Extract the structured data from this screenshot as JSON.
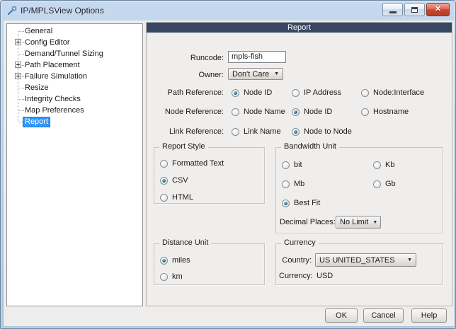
{
  "window": {
    "title": "IP/MPLSView Options"
  },
  "icons": {
    "app": "wrench-icon",
    "minimize": "minimize-icon",
    "maximize": "maximize-icon",
    "close": "close-icon",
    "close_glyph": "✕",
    "dropdown_arrow": "▼"
  },
  "tree": {
    "items": [
      {
        "label": "General",
        "expandable": false,
        "selected": false
      },
      {
        "label": "Config Editor",
        "expandable": true,
        "selected": false
      },
      {
        "label": "Demand/Tunnel Sizing",
        "expandable": false,
        "selected": false
      },
      {
        "label": "Path Placement",
        "expandable": true,
        "selected": false
      },
      {
        "label": "Failure Simulation",
        "expandable": true,
        "selected": false
      },
      {
        "label": "Resize",
        "expandable": false,
        "selected": false
      },
      {
        "label": "Integrity Checks",
        "expandable": false,
        "selected": false
      },
      {
        "label": "Map Preferences",
        "expandable": false,
        "selected": false
      },
      {
        "label": "Report",
        "expandable": false,
        "selected": true
      }
    ]
  },
  "report_panel": {
    "header": "Report",
    "runcode": {
      "label": "Runcode:",
      "value": "mpls-fish"
    },
    "owner": {
      "label": "Owner:",
      "value": "Don't Care"
    },
    "path_reference": {
      "label": "Path Reference:",
      "options": [
        "Node ID",
        "IP Address",
        "Node:Interface"
      ],
      "selected": "Node ID"
    },
    "node_reference": {
      "label": "Node Reference:",
      "options": [
        "Node Name",
        "Node ID",
        "Hostname"
      ],
      "selected": "Node ID"
    },
    "link_reference": {
      "label": "Link Reference:",
      "options": [
        "Link Name",
        "Node to Node"
      ],
      "selected": "Node to Node"
    },
    "report_style": {
      "title": "Report Style",
      "options": [
        "Formatted Text",
        "CSV",
        "HTML"
      ],
      "selected": "CSV"
    },
    "bandwidth_unit": {
      "title": "Bandwidth Unit",
      "options": [
        "bit",
        "Kb",
        "Mb",
        "Gb",
        "Best Fit"
      ],
      "selected": "Best Fit",
      "decimal_places": {
        "label": "Decimal Places:",
        "value": "No Limit"
      }
    },
    "distance_unit": {
      "title": "Distance Unit",
      "options": [
        "miles",
        "km"
      ],
      "selected": "miles"
    },
    "currency": {
      "title": "Currency",
      "country": {
        "label": "Country:",
        "value": "US UNITED_STATES"
      },
      "currency": {
        "label": "Currency:",
        "value": "USD"
      }
    }
  },
  "footer": {
    "ok": "OK",
    "cancel": "Cancel",
    "help": "Help"
  },
  "colors": {
    "header_bg": "#374763",
    "selection_bg": "#3296fa",
    "panel_bg": "#efedeb",
    "frame": "#b2cbe4",
    "close_red": "#c94730",
    "radio_dot": "#0b4a6b"
  }
}
